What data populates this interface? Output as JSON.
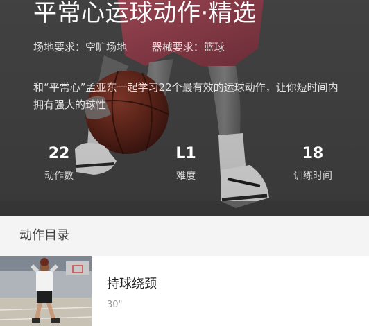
{
  "hero": {
    "title": "平常心运球动作·精选",
    "venue_requirement": "场地要求：空旷场地",
    "equipment_requirement": "器械要求：篮球",
    "description": "和“平常心”孟亚东一起学习22个最有效的运球动作，让你短时间内拥有强大的球性",
    "stats": [
      {
        "value": "22",
        "label": "动作数"
      },
      {
        "value": "L1",
        "label": "难度"
      },
      {
        "value": "18",
        "label": "训练时间"
      }
    ]
  },
  "section": {
    "title": "动作目录"
  },
  "actions": [
    {
      "name": "持球绕颈",
      "duration": "30\""
    }
  ]
}
